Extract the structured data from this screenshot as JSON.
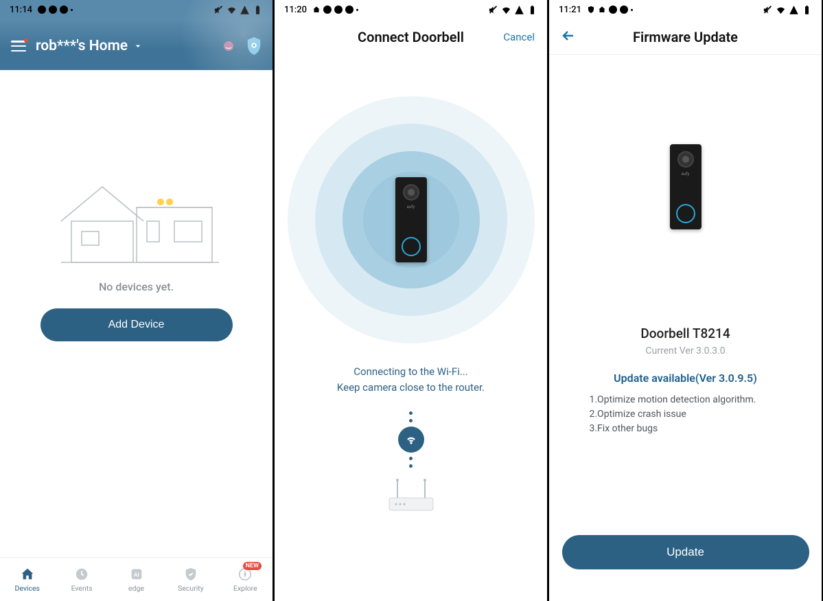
{
  "screen1": {
    "status_time": "11:14",
    "header_title": "rob***'s Home",
    "empty_text": "No devices yet.",
    "add_button": "Add Device",
    "nav": [
      {
        "label": "Devices"
      },
      {
        "label": "Events"
      },
      {
        "label": "edge"
      },
      {
        "label": "Security"
      },
      {
        "label": "Explore"
      }
    ],
    "new_badge": "NEW"
  },
  "screen2": {
    "status_time": "11:20",
    "title": "Connect Doorbell",
    "cancel": "Cancel",
    "line1": "Connecting to the Wi-Fi...",
    "line2": "Keep camera close to the router."
  },
  "screen3": {
    "status_time": "11:21",
    "title": "Firmware Update",
    "device_name": "Doorbell T8214",
    "current_ver": "Current Ver 3.0.3.0",
    "update_available": "Update available(Ver 3.0.9.5)",
    "changes": [
      "1.Optimize motion detection algorithm.",
      "2.Optimize crash issue",
      "3.Fix other bugs"
    ],
    "update_button": "Update"
  }
}
